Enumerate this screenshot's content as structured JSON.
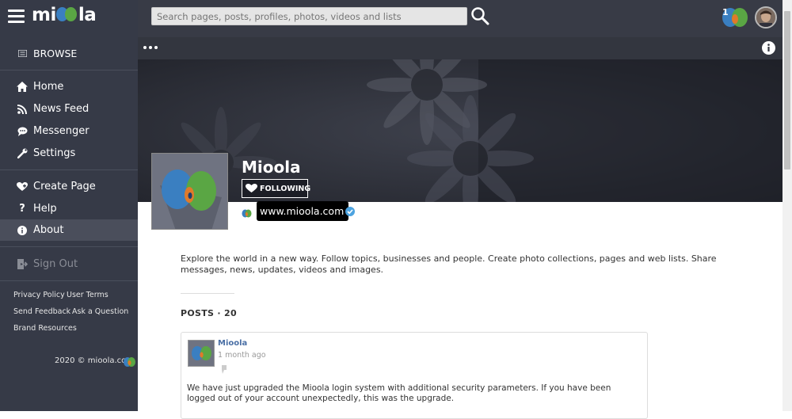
{
  "brand": {
    "logo_text_left": "mi",
    "logo_text_right": "la"
  },
  "sidebar": {
    "browse_label": "BROWSE",
    "items": [
      {
        "label": "Home",
        "icon": "home-icon"
      },
      {
        "label": "News Feed",
        "icon": "rss-icon"
      },
      {
        "label": "Messenger",
        "icon": "chat-icon"
      },
      {
        "label": "Settings",
        "icon": "wrench-icon"
      },
      {
        "label": "Create Page",
        "icon": "heart-plus-icon"
      },
      {
        "label": "Help",
        "icon": "question-icon"
      },
      {
        "label": "About",
        "icon": "info-icon"
      },
      {
        "label": "Sign Out",
        "icon": "sign-out-icon"
      }
    ],
    "links": [
      "Privacy Policy",
      "User Terms",
      "Send Feedback",
      "Ask a Question",
      "Brand Resources"
    ],
    "copyright": "2020 © mioola.com"
  },
  "search": {
    "placeholder": "Search pages, posts, profiles, photos, videos and lists"
  },
  "notifications": {
    "count": "1"
  },
  "profile": {
    "name": "Mioola",
    "follow_label": "FOLLOWING",
    "website": "www.mioola.com",
    "about": "Explore the world in a new way. Follow topics, businesses and people. Create photo collections, pages and web lists. Share messages, news, updates, videos and images."
  },
  "posts": {
    "header": "POSTS · 20",
    "items": [
      {
        "author": "Mioola",
        "time": "1 month ago",
        "body": "We have just upgraded the Mioola login system with additional security parameters. If you have been logged out of your account unexpectedly, this was the upgrade."
      }
    ]
  },
  "colors": {
    "sidebar_bg": "#363a47",
    "accent_blue": "#3a7fc1",
    "accent_green": "#5aa644",
    "accent_orange": "#e07a2a",
    "link_blue": "#4a6fa5"
  }
}
